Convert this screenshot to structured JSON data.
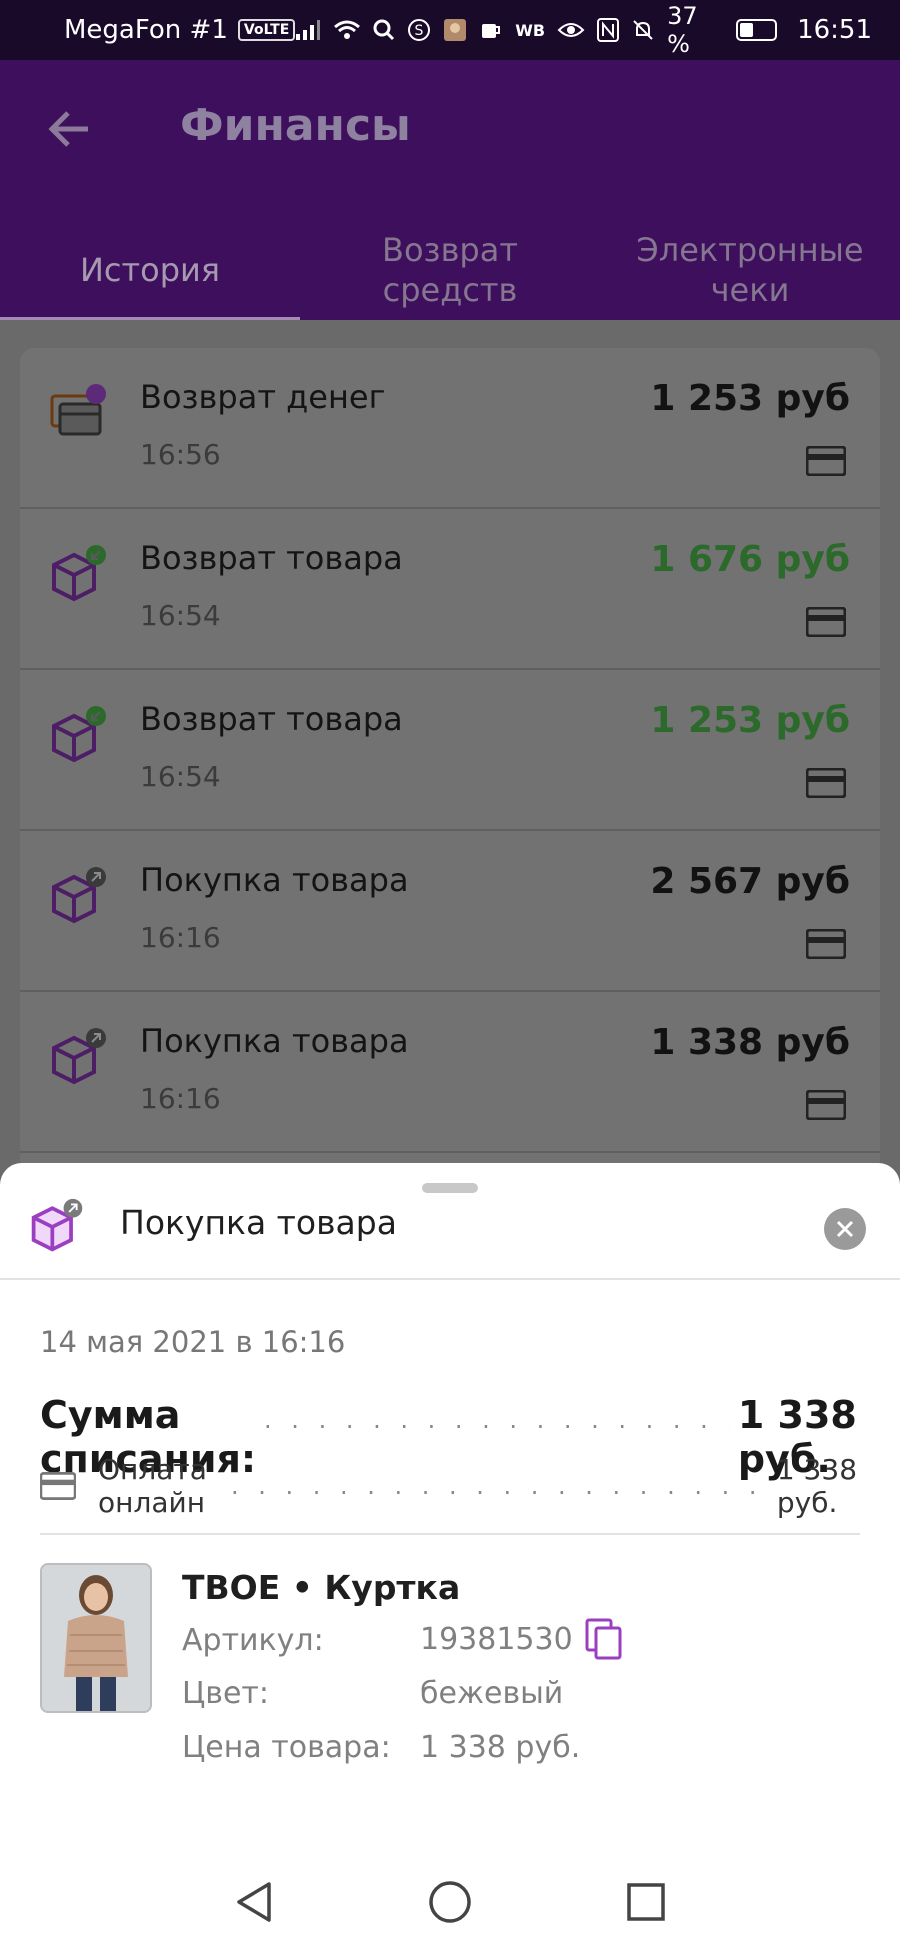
{
  "status_bar": {
    "carrier": "MegaFon #1",
    "volte": "VoLTE",
    "wb": "WB",
    "battery": "37 %",
    "time": "16:51"
  },
  "app_bar": {
    "title": "Финансы",
    "tabs": [
      {
        "label": "История",
        "active": true
      },
      {
        "label": "Возврат средств",
        "active": false
      },
      {
        "label": "Электронные чеки",
        "active": false
      }
    ]
  },
  "history": [
    {
      "title": "Возврат денег",
      "time": "16:56",
      "amount": "1 253 руб",
      "positive": false,
      "icon": "wallet-refund-icon"
    },
    {
      "title": "Возврат товара",
      "time": "16:54",
      "amount": "1 676 руб",
      "positive": true,
      "icon": "box-return-icon"
    },
    {
      "title": "Возврат товара",
      "time": "16:54",
      "amount": "1 253 руб",
      "positive": true,
      "icon": "box-return-icon"
    },
    {
      "title": "Покупка товара",
      "time": "16:16",
      "amount": "2 567 руб",
      "positive": false,
      "icon": "box-purchase-icon"
    },
    {
      "title": "Покупка товара",
      "time": "16:16",
      "amount": "1 338 руб",
      "positive": false,
      "icon": "box-purchase-icon"
    }
  ],
  "sheet": {
    "title": "Покупка товара",
    "date": "14 мая 2021 в 16:16",
    "sum_label": "Сумма списания:",
    "sum_value": "1 338 руб.",
    "payment_label": "Оплата онлайн",
    "payment_value": "1 338 руб.",
    "product": {
      "name": "ТВОЕ • Куртка",
      "article_label": "Артикул:",
      "article_value": "19381530",
      "color_label": "Цвет:",
      "color_value": "бежевый",
      "price_label": "Цена товара:",
      "price_value": "1 338 руб."
    }
  },
  "colors": {
    "accent": "#9b3fc0",
    "positive": "#2b6a2b",
    "appbar": "#3e0f5c"
  }
}
